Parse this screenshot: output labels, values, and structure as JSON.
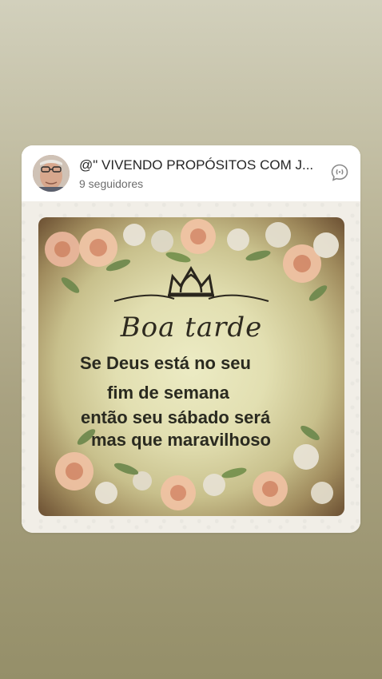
{
  "post": {
    "author_name": "@\" VIVENDO PROPÓSITOS COM J...",
    "followers": "9 seguidores",
    "chat_icon": "chat-bubble-icon",
    "image": {
      "greeting": "Boa tarde",
      "lines": [
        "Se Deus está no seu",
        "fim de semana",
        "então seu sábado  será",
        "mas que maravilhoso"
      ],
      "decoration": "crown-icon"
    }
  }
}
